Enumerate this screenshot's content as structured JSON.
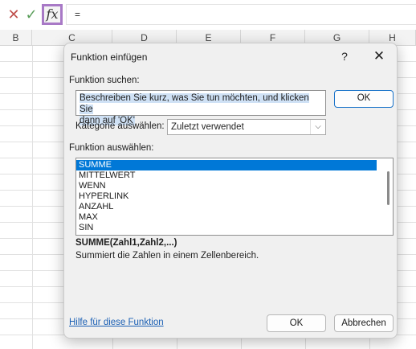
{
  "formula_bar": {
    "cancel_icon": "✕",
    "enter_icon": "✓",
    "fx_label": "fx",
    "formula_value": "="
  },
  "columns": [
    "B",
    "C",
    "D",
    "E",
    "F",
    "G",
    "H"
  ],
  "dialog": {
    "title": "Funktion einfügen",
    "help_icon": "?",
    "close_icon": "✕",
    "search_label": "Funktion suchen:",
    "search_value_line1": "Beschreiben Sie kurz, was Sie tun möchten, und klicken Sie",
    "search_value_line2": "dann auf 'OK'",
    "search_ok": "OK",
    "category_label": "Kategorie auswählen:",
    "category_value": "Zuletzt verwendet",
    "function_label": "Funktion auswählen:",
    "functions": [
      "SUMME",
      "MITTELWERT",
      "WENN",
      "HYPERLINK",
      "ANZAHL",
      "MAX",
      "SIN"
    ],
    "selected_function": "SUMME",
    "signature": "SUMME(Zahl1,Zahl2,...)",
    "description": "Summiert die Zahlen in einem Zellenbereich.",
    "help_link": "Hilfe für diese Funktion",
    "ok_button": "OK",
    "cancel_button": "Abbrechen"
  }
}
